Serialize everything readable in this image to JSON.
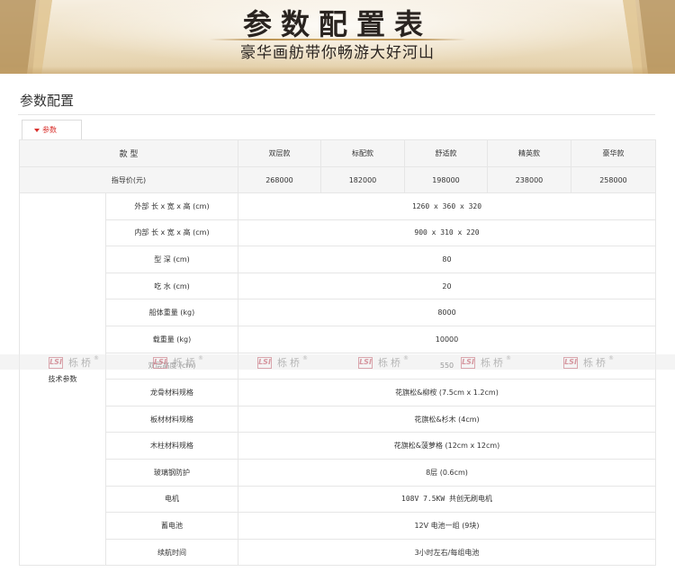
{
  "banner": {
    "title": "参数配置表",
    "subtitle": "豪华画舫带你畅游大好河山"
  },
  "section": {
    "title": "参数配置"
  },
  "tab": {
    "label": "参数"
  },
  "table": {
    "model_header": "款 型",
    "models": [
      "双层款",
      "标配款",
      "舒适款",
      "精英款",
      "豪华款"
    ],
    "price": {
      "label": "指导价(元)",
      "values": [
        "268000",
        "182000",
        "198000",
        "238000",
        "258000"
      ]
    },
    "group_label": "技术参数",
    "rows": [
      {
        "label": "外部 长 x 宽 x 高 (cm)",
        "value": "1260 x 360 x 320"
      },
      {
        "label": "内部 长 x 宽 x 高 (cm)",
        "value": "900 x 310 x 220"
      },
      {
        "label": "型 深 (cm)",
        "value": "80"
      },
      {
        "label": "吃 水 (cm)",
        "value": "20"
      },
      {
        "label": "船体重量 (kg)",
        "value": "8000"
      },
      {
        "label": "载重量 (kg)",
        "value": "10000"
      },
      {
        "label": "双层高度 (cm)",
        "value": "550"
      },
      {
        "label": "龙骨材料规格",
        "value": "花旗松&柳桉 (7.5cm x 1.2cm)"
      },
      {
        "label": "板材材料规格",
        "value": "花旗松&杉木 (4cm)"
      },
      {
        "label": "木柱材料规格",
        "value": "花旗松&菠萝格 (12cm x 12cm)"
      },
      {
        "label": "玻璃钢防护",
        "value": "8层 (0.6cm)"
      },
      {
        "label": "电机",
        "value": "108V 7.5KW 共创无刷电机"
      },
      {
        "label": "蓄电池",
        "value": "12V 电池一组 (9块)"
      },
      {
        "label": "续航时间",
        "value": "3小时左右/每组电池"
      }
    ]
  },
  "watermark": {
    "logo_text": "LSI",
    "name": "栎桥",
    "mark": "®"
  },
  "colors": {
    "banner_gold": "#b88f4e",
    "tab_accent": "#d9302c",
    "header_bg": "#f5f5f5",
    "border": "#e6e6e6"
  }
}
